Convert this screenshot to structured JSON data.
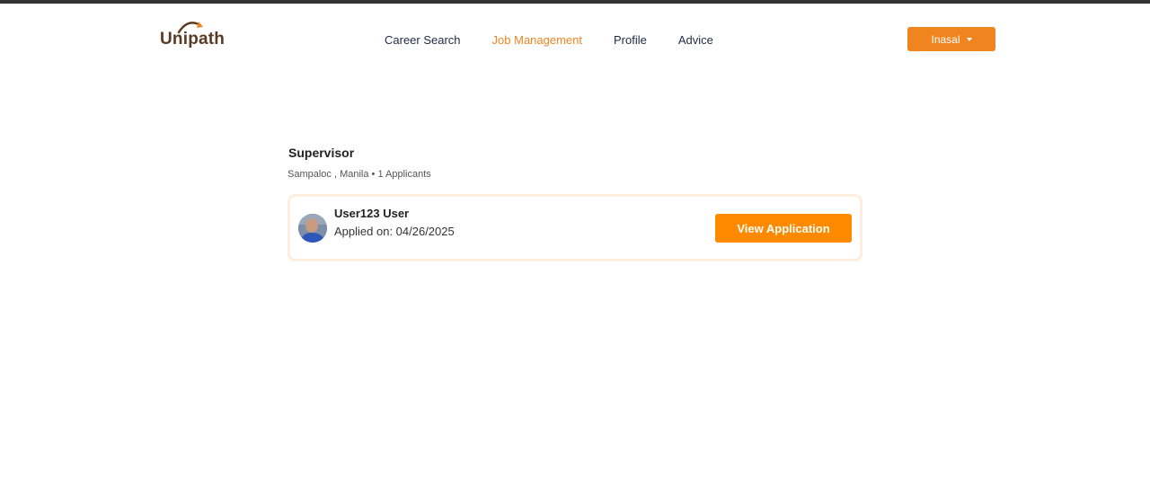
{
  "brand": {
    "name": "Unipath",
    "logo_icon": "arc-arrow-icon",
    "text_color": "#5b3a24",
    "accent_color": "#f0851f"
  },
  "nav": {
    "items": [
      {
        "label": "Career Search",
        "active": false
      },
      {
        "label": "Job Management",
        "active": true
      },
      {
        "label": "Profile",
        "active": false
      },
      {
        "label": "Advice",
        "active": false
      }
    ],
    "active_color": "#f0851f"
  },
  "user_menu": {
    "label": "Inasal",
    "icon": "caret-down-icon",
    "color": "#f0851f"
  },
  "job": {
    "title": "Supervisor",
    "meta": "Sampaloc , Manila • 1 Applicants"
  },
  "applicants": [
    {
      "name": "User123 User",
      "applied_on": "Applied on: 04/26/2025",
      "action_label": "View Application",
      "avatar_icon": "user-avatar"
    }
  ],
  "colors": {
    "primary_button": "#ff8a00",
    "card_border": "#fdeee0",
    "top_strip": "#333333"
  }
}
